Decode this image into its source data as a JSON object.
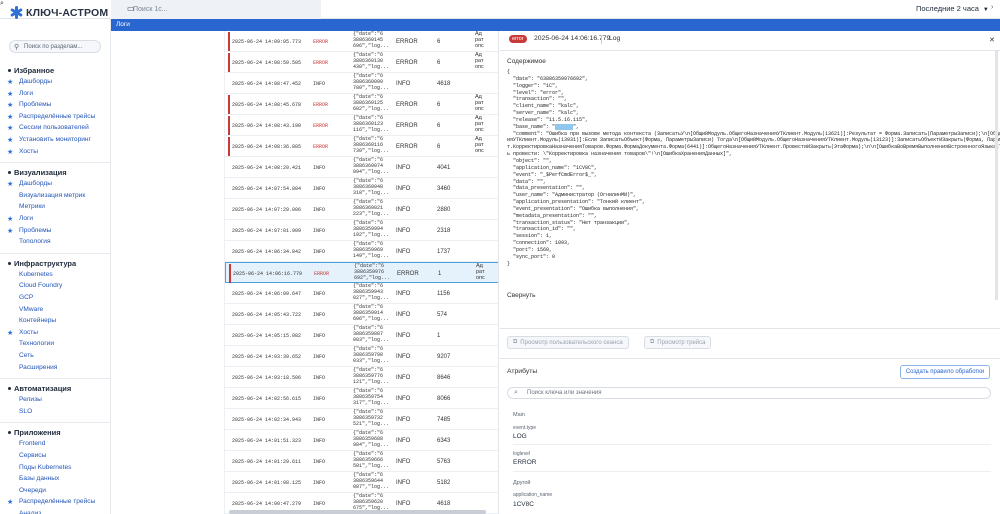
{
  "app": {
    "title": "КЛЮЧ-АСТРОМ",
    "search_placeholder": "Поиск 1с...",
    "time_range": "Последние 2 часа"
  },
  "breadcrumb": "Логи",
  "sidebar": {
    "search_placeholder": "Поиск по разделам...",
    "sections": [
      {
        "title": "Избранное",
        "items": [
          {
            "label": "Дашборды",
            "star": true
          },
          {
            "label": "Логи",
            "star": true
          },
          {
            "label": "Проблемы",
            "star": true
          },
          {
            "label": "Распределённые трейсы",
            "star": true
          },
          {
            "label": "Сессии пользователей",
            "star": true
          },
          {
            "label": "Установить мониторинг",
            "star": true
          },
          {
            "label": "Хосты",
            "star": true
          }
        ]
      },
      {
        "title": "Визуализация",
        "items": [
          {
            "label": "Дашборды",
            "star": true
          },
          {
            "label": "Визуализация метрик",
            "star": false
          },
          {
            "label": "Метрики",
            "star": false
          },
          {
            "label": "Логи",
            "star": true
          },
          {
            "label": "Проблемы",
            "star": true
          },
          {
            "label": "Топология",
            "star": false
          }
        ]
      },
      {
        "title": "Инфраструктура",
        "items": [
          {
            "label": "Kubernetes",
            "star": false
          },
          {
            "label": "Cloud Foundry",
            "star": false
          },
          {
            "label": "GCP",
            "star": false
          },
          {
            "label": "VMware",
            "star": false
          },
          {
            "label": "Контейнеры",
            "star": false
          },
          {
            "label": "Хосты",
            "star": true
          },
          {
            "label": "Технологии",
            "star": false
          },
          {
            "label": "Сеть",
            "star": false
          },
          {
            "label": "Расширения",
            "star": false
          }
        ]
      },
      {
        "title": "Автоматизация",
        "items": [
          {
            "label": "Релизы",
            "star": false
          },
          {
            "label": "SLO",
            "star": false
          }
        ]
      },
      {
        "title": "Приложения",
        "items": [
          {
            "label": "Frontend",
            "star": false
          },
          {
            "label": "Сервисы",
            "star": false
          },
          {
            "label": "Поды Kubernetes",
            "star": false
          },
          {
            "label": "Базы данных",
            "star": false
          },
          {
            "label": "Очереди",
            "star": false
          },
          {
            "label": "Распределённые трейсы",
            "star": true
          },
          {
            "label": "Анализ",
            "star": false
          }
        ]
      }
    ]
  },
  "log_rows": [
    {
      "time": "2025-06-24 14:09:05.773",
      "level": "ERROR",
      "json": [
        "{\"date\":\"6",
        "3886360145",
        "696\",\"log..."
      ],
      "lvl": "ERROR",
      "num": "6",
      "ad": [
        "Ад",
        "рат",
        "опс"
      ]
    },
    {
      "time": "2025-06-24 14:08:50.505",
      "level": "ERROR",
      "json": [
        "{\"date\":\"6",
        "3886360130",
        "430\",\"log..."
      ],
      "lvl": "ERROR",
      "num": "6",
      "ad": [
        "Ад",
        "рат",
        "опс"
      ]
    },
    {
      "time": "2025-06-24 14:08:47.452",
      "level": "INFO",
      "json": [
        "{\"date\":\"6",
        "3886360099",
        "780\",\"log..."
      ],
      "lvl": "INFO",
      "num": "4618",
      "ad": [
        "",
        "",
        ""
      ]
    },
    {
      "time": "2025-06-24 14:08:45.678",
      "level": "ERROR",
      "json": [
        "{\"date\":\"6",
        "3886360125",
        "602\",\"log..."
      ],
      "lvl": "ERROR",
      "num": "6",
      "ad": [
        "Ад",
        "рат",
        "опс"
      ]
    },
    {
      "time": "2025-06-24 14:08:43.190",
      "level": "ERROR",
      "json": [
        "{\"date\":\"6",
        "3886360123",
        "116\",\"log..."
      ],
      "lvl": "ERROR",
      "num": "6",
      "ad": [
        "Ад",
        "рат",
        "опс"
      ]
    },
    {
      "time": "2025-06-24 14:08:36.805",
      "level": "ERROR",
      "json": [
        "{\"date\":\"6",
        "3886360116",
        "730\",\"log..."
      ],
      "lvl": "ERROR",
      "num": "6",
      "ad": [
        "Ад",
        "рат",
        "опс"
      ]
    },
    {
      "time": "2025-06-24 14:08:20.421",
      "level": "INFO",
      "json": [
        "{\"date\":\"6",
        "3886360074",
        "094\",\"log..."
      ],
      "lvl": "INFO",
      "num": "4041",
      "ad": [
        "",
        "",
        ""
      ]
    },
    {
      "time": "2025-06-24 14:07:54.804",
      "level": "INFO",
      "json": [
        "{\"date\":\"6",
        "3886360048",
        "318\",\"log..."
      ],
      "lvl": "INFO",
      "num": "3460",
      "ad": [
        "",
        "",
        ""
      ]
    },
    {
      "time": "2025-06-24 14:07:29.006",
      "level": "INFO",
      "json": [
        "{\"date\":\"6",
        "3886360021",
        "223\",\"log..."
      ],
      "lvl": "INFO",
      "num": "2880",
      "ad": [
        "",
        "",
        ""
      ]
    },
    {
      "time": "2025-06-24 14:07:01.909",
      "level": "INFO",
      "json": [
        "{\"date\":\"6",
        "3886359994",
        "192\",\"log..."
      ],
      "lvl": "INFO",
      "num": "2318",
      "ad": [
        "",
        "",
        ""
      ]
    },
    {
      "time": "2025-06-24 14:06:34.842",
      "level": "INFO",
      "json": [
        "{\"date\":\"6",
        "3886359969",
        "149\",\"log..."
      ],
      "lvl": "INFO",
      "num": "1737",
      "ad": [
        "",
        "",
        ""
      ]
    },
    {
      "time": "2025-06-24 14:06:16.779",
      "level": "ERROR",
      "json": [
        "{\"date\":\"6",
        "3886359976",
        "692\",\"log..."
      ],
      "lvl": "ERROR",
      "num": "1",
      "ad": [
        "Ад",
        "рат",
        "опс"
      ],
      "selected": true
    },
    {
      "time": "2025-06-24 14:06:09.647",
      "level": "INFO",
      "json": [
        "{\"date\":\"6",
        "3886359943",
        "027\",\"log..."
      ],
      "lvl": "INFO",
      "num": "1156",
      "ad": [
        "",
        "",
        ""
      ]
    },
    {
      "time": "2025-06-24 14:05:43.722",
      "level": "INFO",
      "json": [
        "{\"date\":\"6",
        "3886359914",
        "606\",\"log..."
      ],
      "lvl": "INFO",
      "num": "574",
      "ad": [
        "",
        "",
        ""
      ]
    },
    {
      "time": "2025-06-24 14:05:15.082",
      "level": "INFO",
      "json": [
        "{\"date\":\"6",
        "3886359887",
        "003\",\"log..."
      ],
      "lvl": "INFO",
      "num": "1",
      "ad": [
        "",
        "",
        ""
      ]
    },
    {
      "time": "2025-06-24 14:03:39.652",
      "level": "INFO",
      "json": [
        "{\"date\":\"6",
        "3886359798",
        "033\",\"log..."
      ],
      "lvl": "INFO",
      "num": "9207",
      "ad": [
        "",
        "",
        ""
      ]
    },
    {
      "time": "2025-06-24 14:03:18.506",
      "level": "INFO",
      "json": [
        "{\"date\":\"6",
        "3886359776",
        "121\",\"log..."
      ],
      "lvl": "INFO",
      "num": "8646",
      "ad": [
        "",
        "",
        ""
      ]
    },
    {
      "time": "2025-06-24 14:02:56.615",
      "level": "INFO",
      "json": [
        "{\"date\":\"6",
        "3886359754",
        "317\",\"log..."
      ],
      "lvl": "INFO",
      "num": "8066",
      "ad": [
        "",
        "",
        ""
      ]
    },
    {
      "time": "2025-06-24 14:02:34.943",
      "level": "INFO",
      "json": [
        "{\"date\":\"6",
        "3886359732",
        "521\",\"log..."
      ],
      "lvl": "INFO",
      "num": "7485",
      "ad": [
        "",
        "",
        ""
      ]
    },
    {
      "time": "2025-06-24 14:01:51.323",
      "level": "INFO",
      "json": [
        "{\"date\":\"6",
        "3886359688",
        "984\",\"log..."
      ],
      "lvl": "INFO",
      "num": "6343",
      "ad": [
        "",
        "",
        ""
      ]
    },
    {
      "time": "2025-06-24 14:01:29.611",
      "level": "INFO",
      "json": [
        "{\"date\":\"6",
        "3886359666",
        "501\",\"log..."
      ],
      "lvl": "INFO",
      "num": "5763",
      "ad": [
        "",
        "",
        ""
      ]
    },
    {
      "time": "2025-06-24 14:01:08.125",
      "level": "INFO",
      "json": [
        "{\"date\":\"6",
        "3886359644",
        "087\",\"log..."
      ],
      "lvl": "INFO",
      "num": "5182",
      "ad": [
        "",
        "",
        ""
      ]
    },
    {
      "time": "2025-06-24 14:00:47.279",
      "level": "INFO",
      "json": [
        "{\"date\":\"6",
        "3886359620",
        "675\",\"log..."
      ],
      "lvl": "INFO",
      "num": "4618",
      "ad": [
        "",
        "",
        ""
      ]
    },
    {
      "time": "",
      "level": "",
      "json": [
        "{\"date\":\"6",
        "",
        ""
      ],
      "lvl": "",
      "num": "",
      "ad": [
        "",
        "",
        ""
      ]
    }
  ],
  "detail": {
    "badge": "error",
    "time": "2025-06-24 14:06:16.779",
    "type": "Log",
    "content_label": "Содержимое",
    "code_lines": [
      "{",
      "  \"date\": \"63886359976692\",",
      "  \"logger\": \"1C\",",
      "  \"level\": \"error\",",
      "  \"transaction\": \"\",",
      "  \"client_name\": \"kalc\",",
      "  \"server_name\": \"kalc\",",
      "  \"release\": \"11.5.16.115\",",
      "  \"base_name\": \"__HL__\",",
      "  \"comment\": \"Ошибка при вызове метода контекста (ЗаписатьУ\\n[ОбщийМодуль.ОбщегоНазначенияУТКлиент.Модуль(13621)]:Результат = Форма.Записать(ПараметрыЗаписи);\\n[ОбщийМодуль.ОбщегоНазначения",
      "ияУТКлиент.Модуль(13931)]:Если ЗаписатьОбъект(Форма, ПараметрыЗаписи) Тогда\\n[ОбщийМодуль.ОбщегоНазначенияУТКлиент.Модуль(13123)]:ЗаписатьОбъектИЗакрыть(Форма, ПараметрыЗаписи);\\n[Документ",
      "т.КорректировкаНазначенияТоваров.Форма.ФормаДокумента.Форма(6441)]:ОбщегоНазначенияУТКлиент.ПровестиИЗакрыть(ЭтаФорма);\\n\\n[ОшибкаВоВремяВыполненияВстроенногоЯзыка]\\nпо причине:\\nНе удалось",
      "ь провести: \\\"Корректировка назначения товаров\\\"!\\n[ОшибкаХраненияДанных]\",",
      "  \"object\": \"\",",
      "  \"application_name\": \"1CV8C\",",
      "  \"event\": \"_$PerfCmdError$_\",",
      "  \"data\": \"\",",
      "  \"data_presentation\": \"\",",
      "  \"user_name\": \"Администратор (ОгнилинМИ)\",",
      "  \"application_presentation\": \"Тонкий клиент\",",
      "  \"event_presentation\": \"Ошибка выполнения\",",
      "  \"metadata_presentation\": \"\",",
      "  \"transaction_status\": \"Нет транзакции\",",
      "  \"transaction_id\": \"\",",
      "  \"session\": 1,",
      "  \"connection\": 1093,",
      "  \"port\": 1560,",
      "  \"sync_port\": 0",
      "}"
    ],
    "collapse_label": "Свернуть",
    "btn_user_session": "Просмотр пользовательского сеанса",
    "btn_trace": "Просмотр трейса",
    "attributes_label": "Атрибуты",
    "create_rule_label": "Создать правило обработки",
    "attr_search_placeholder": "Поиск ключа или значения",
    "main_group": "Main",
    "attrs_main": [
      {
        "key": "event.type",
        "value": "LOG"
      },
      {
        "key": "loglevel",
        "value": "ERROR"
      }
    ],
    "other_group": "Другой",
    "attrs_other": [
      {
        "key": "application_name",
        "value": "1CV8C"
      }
    ]
  },
  "colors": {
    "accent": "#2a66d0",
    "error": "#c83a3a",
    "selected_row": "#e6f2fb"
  }
}
